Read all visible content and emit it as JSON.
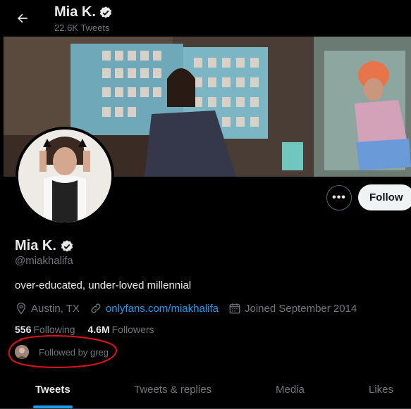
{
  "header": {
    "name": "Mia K.",
    "tweet_count": "22.6K Tweets"
  },
  "profile": {
    "name": "Mia K.",
    "handle": "@miakhalifa",
    "bio": "over-educated, under-loved millennial",
    "location": "Austin, TX",
    "website": "onlyfans.com/miakhalifa",
    "joined": "Joined September 2014"
  },
  "actions": {
    "more_label": "•••",
    "follow_label": "Follow"
  },
  "stats": {
    "following_count": "556",
    "following_label": "Following",
    "followers_count": "4.6M",
    "followers_label": "Followers"
  },
  "followed_by": "Followed by greg",
  "tabs": [
    "Tweets",
    "Tweets & replies",
    "Media",
    "Likes"
  ],
  "colors": {
    "accent": "#1d9bf0",
    "annotation": "#e0101a",
    "background": "#000000"
  }
}
